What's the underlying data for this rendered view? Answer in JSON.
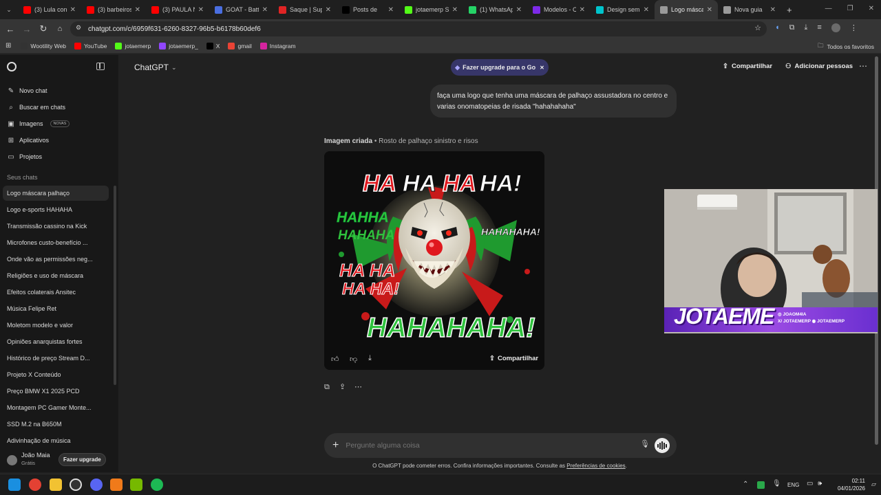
{
  "browser": {
    "tabs": [
      {
        "title": "(3) Lula conc",
        "icon": "youtube-icon",
        "color": "#ff0000"
      },
      {
        "title": "(3) barbeiros",
        "icon": "youtube-icon",
        "color": "#ff0000"
      },
      {
        "title": "(3) PAULA N",
        "icon": "youtube-icon",
        "color": "#ff0000"
      },
      {
        "title": "GOAT - Batt",
        "icon": "goat-icon",
        "color": "#4a6ee0"
      },
      {
        "title": "Saque | Supe",
        "icon": "s-icon",
        "color": "#e02424"
      },
      {
        "title": "Posts de",
        "icon": "x-icon",
        "color": "#000000"
      },
      {
        "title": "jotaemerp S",
        "icon": "kick-icon",
        "color": "#53fc18"
      },
      {
        "title": "(1) WhatsAp",
        "icon": "whatsapp-icon",
        "color": "#25d366"
      },
      {
        "title": "Modelos - C",
        "icon": "canva-icon",
        "color": "#7d2ae8"
      },
      {
        "title": "Design sem",
        "icon": "canva-icon",
        "color": "#00c4cc"
      },
      {
        "title": "Logo másca",
        "icon": "chatgpt-icon",
        "color": "#9a9a9a"
      },
      {
        "title": "Nova guia",
        "icon": "chrome-icon",
        "color": "#9a9a9a"
      }
    ],
    "active_tab": 10,
    "url": "chatgpt.com/c/6959f631-6260-8327-96b5-b6178b60def6",
    "bookmarks": [
      {
        "label": "Wootility Web",
        "icon": "wooting-icon",
        "color": "#333333"
      },
      {
        "label": "YouTube",
        "icon": "youtube-icon",
        "color": "#ff0000"
      },
      {
        "label": "jotaemerp",
        "icon": "kick-icon",
        "color": "#53fc18"
      },
      {
        "label": "jotaemerp_",
        "icon": "twitch-icon",
        "color": "#9146ff"
      },
      {
        "label": "X",
        "icon": "x-icon",
        "color": "#000000"
      },
      {
        "label": "gmail",
        "icon": "gmail-icon",
        "color": "#ea4335"
      },
      {
        "label": "Instagram",
        "icon": "instagram-icon",
        "color": "#d6249f"
      }
    ],
    "all_bookmarks": "Todos os favoritos"
  },
  "sidebar": {
    "nav": [
      {
        "label": "Novo chat",
        "icon": "new-chat-icon"
      },
      {
        "label": "Buscar em chats",
        "icon": "search-icon"
      },
      {
        "label": "Imagens",
        "icon": "images-icon",
        "badge": "NOVAS"
      },
      {
        "label": "Aplicativos",
        "icon": "apps-icon"
      },
      {
        "label": "Projetos",
        "icon": "folder-icon"
      }
    ],
    "section_title": "Seus chats",
    "chats": [
      "Logo máscara palhaço",
      "Logo e-sports HAHAHA",
      "Transmissão cassino na Kick",
      "Microfones custo-benefício ...",
      "Onde vão as permissões neg...",
      "Religiões e uso de máscara",
      "Efeitos colaterais Ansitec",
      "Música Felipe Ret",
      "Moletom modelo e valor",
      "Opiniões anarquistas fortes",
      "Histórico de preço Stream D...",
      "Projeto X Conteúdo",
      "Preço BMW X1 2025 PCD",
      "Montagem PC Gamer Monte...",
      "SSD M.2 na B650M",
      "Adivinhação de música"
    ],
    "selected_chat": 0,
    "user": {
      "name": "João Maia",
      "plan": "Grátis",
      "upgrade_label": "Fazer upgrade"
    }
  },
  "header": {
    "model": "ChatGPT",
    "upgrade_banner": "Fazer upgrade para o Go",
    "share": "Compartilhar",
    "add_people": "Adicionar pessoas"
  },
  "conversation": {
    "user_message": "faça uma logo que tenha uma máscara de palhaço assustadora no centro e varias onomatopeias de risada \"hahahahaha\"",
    "image_caption_bold": "Imagem criada",
    "image_caption_rest": " • Rosto de palhaço sinistro e risos",
    "image_text": {
      "top": [
        "HA",
        "HA",
        "HA",
        "HA!"
      ],
      "left": [
        "HAHHA",
        "HAHAHA"
      ],
      "right": "HAHAHAHA!",
      "mid_left": [
        "HA HA",
        "HA HA!"
      ],
      "bottom": "HAHAHAHA!"
    },
    "image_share": "Compartilhar"
  },
  "composer": {
    "placeholder": "Pergunte alguma coisa"
  },
  "footer": {
    "disclaimer": "O ChatGPT pode cometer erros. Confira informações importantes. Consulte as ",
    "link": "Preferências de cookies",
    "end": "."
  },
  "webcam": {
    "brand": "JOTAEME",
    "handle1": "JOAOM4IA",
    "handle2": "JOTAEMERP",
    "handle3": "JOTAEMERP"
  },
  "taskbar": {
    "lang": "ENG",
    "time": "02:11",
    "date": "04/01/2026"
  }
}
